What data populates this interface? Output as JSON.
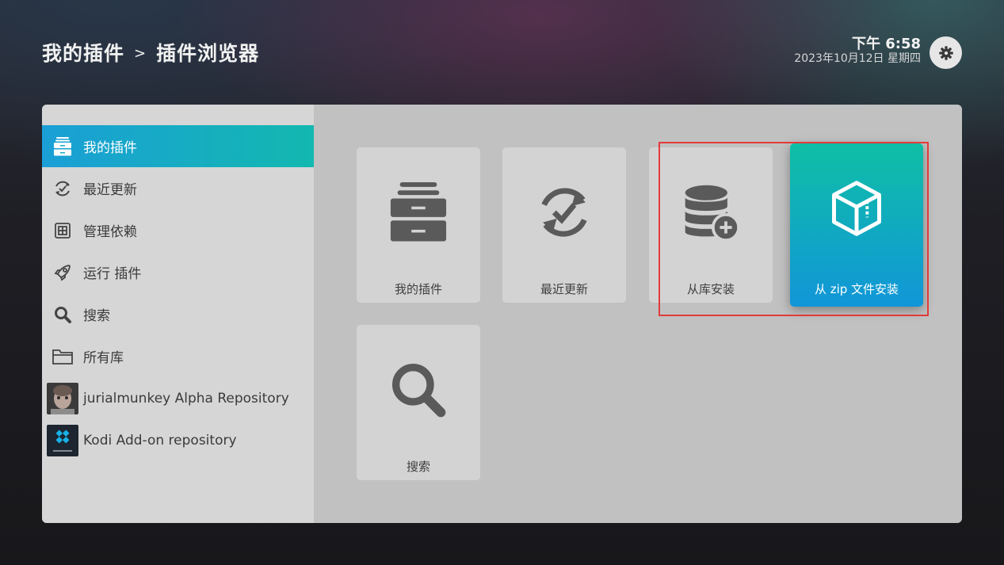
{
  "header": {
    "breadcrumb_root": "我的插件",
    "breadcrumb_sep": ">",
    "breadcrumb_current": "插件浏览器",
    "time": "下午 6:58",
    "date": "2023年10月12日 星期四"
  },
  "sidebar": {
    "items": [
      {
        "label": "我的插件",
        "icon": "addon-box-icon",
        "active": true
      },
      {
        "label": "最近更新",
        "icon": "recent-update-icon"
      },
      {
        "label": "管理依赖",
        "icon": "dependency-icon"
      },
      {
        "label": "运行 插件",
        "icon": "rocket-icon"
      },
      {
        "label": "搜索",
        "icon": "search-icon"
      },
      {
        "label": "所有库",
        "icon": "folder-icon"
      },
      {
        "label": "jurialmunkey Alpha Repository",
        "icon": "repo-avatar"
      },
      {
        "label": "Kodi Add-on repository",
        "icon": "kodi-logo"
      }
    ]
  },
  "tiles": [
    {
      "label": "我的插件",
      "icon": "addon-box-icon"
    },
    {
      "label": "最近更新",
      "icon": "recent-update-icon"
    },
    {
      "label": "从库安装",
      "icon": "install-from-repo-icon"
    },
    {
      "label": "从 zip 文件安装",
      "icon": "zip-package-icon",
      "focused": true
    },
    {
      "label": "搜索",
      "icon": "search-icon"
    }
  ],
  "colors": {
    "accent_start": "#1a9fd6",
    "accent_end": "#13b8b0",
    "highlight_box": "#e33a3a"
  }
}
